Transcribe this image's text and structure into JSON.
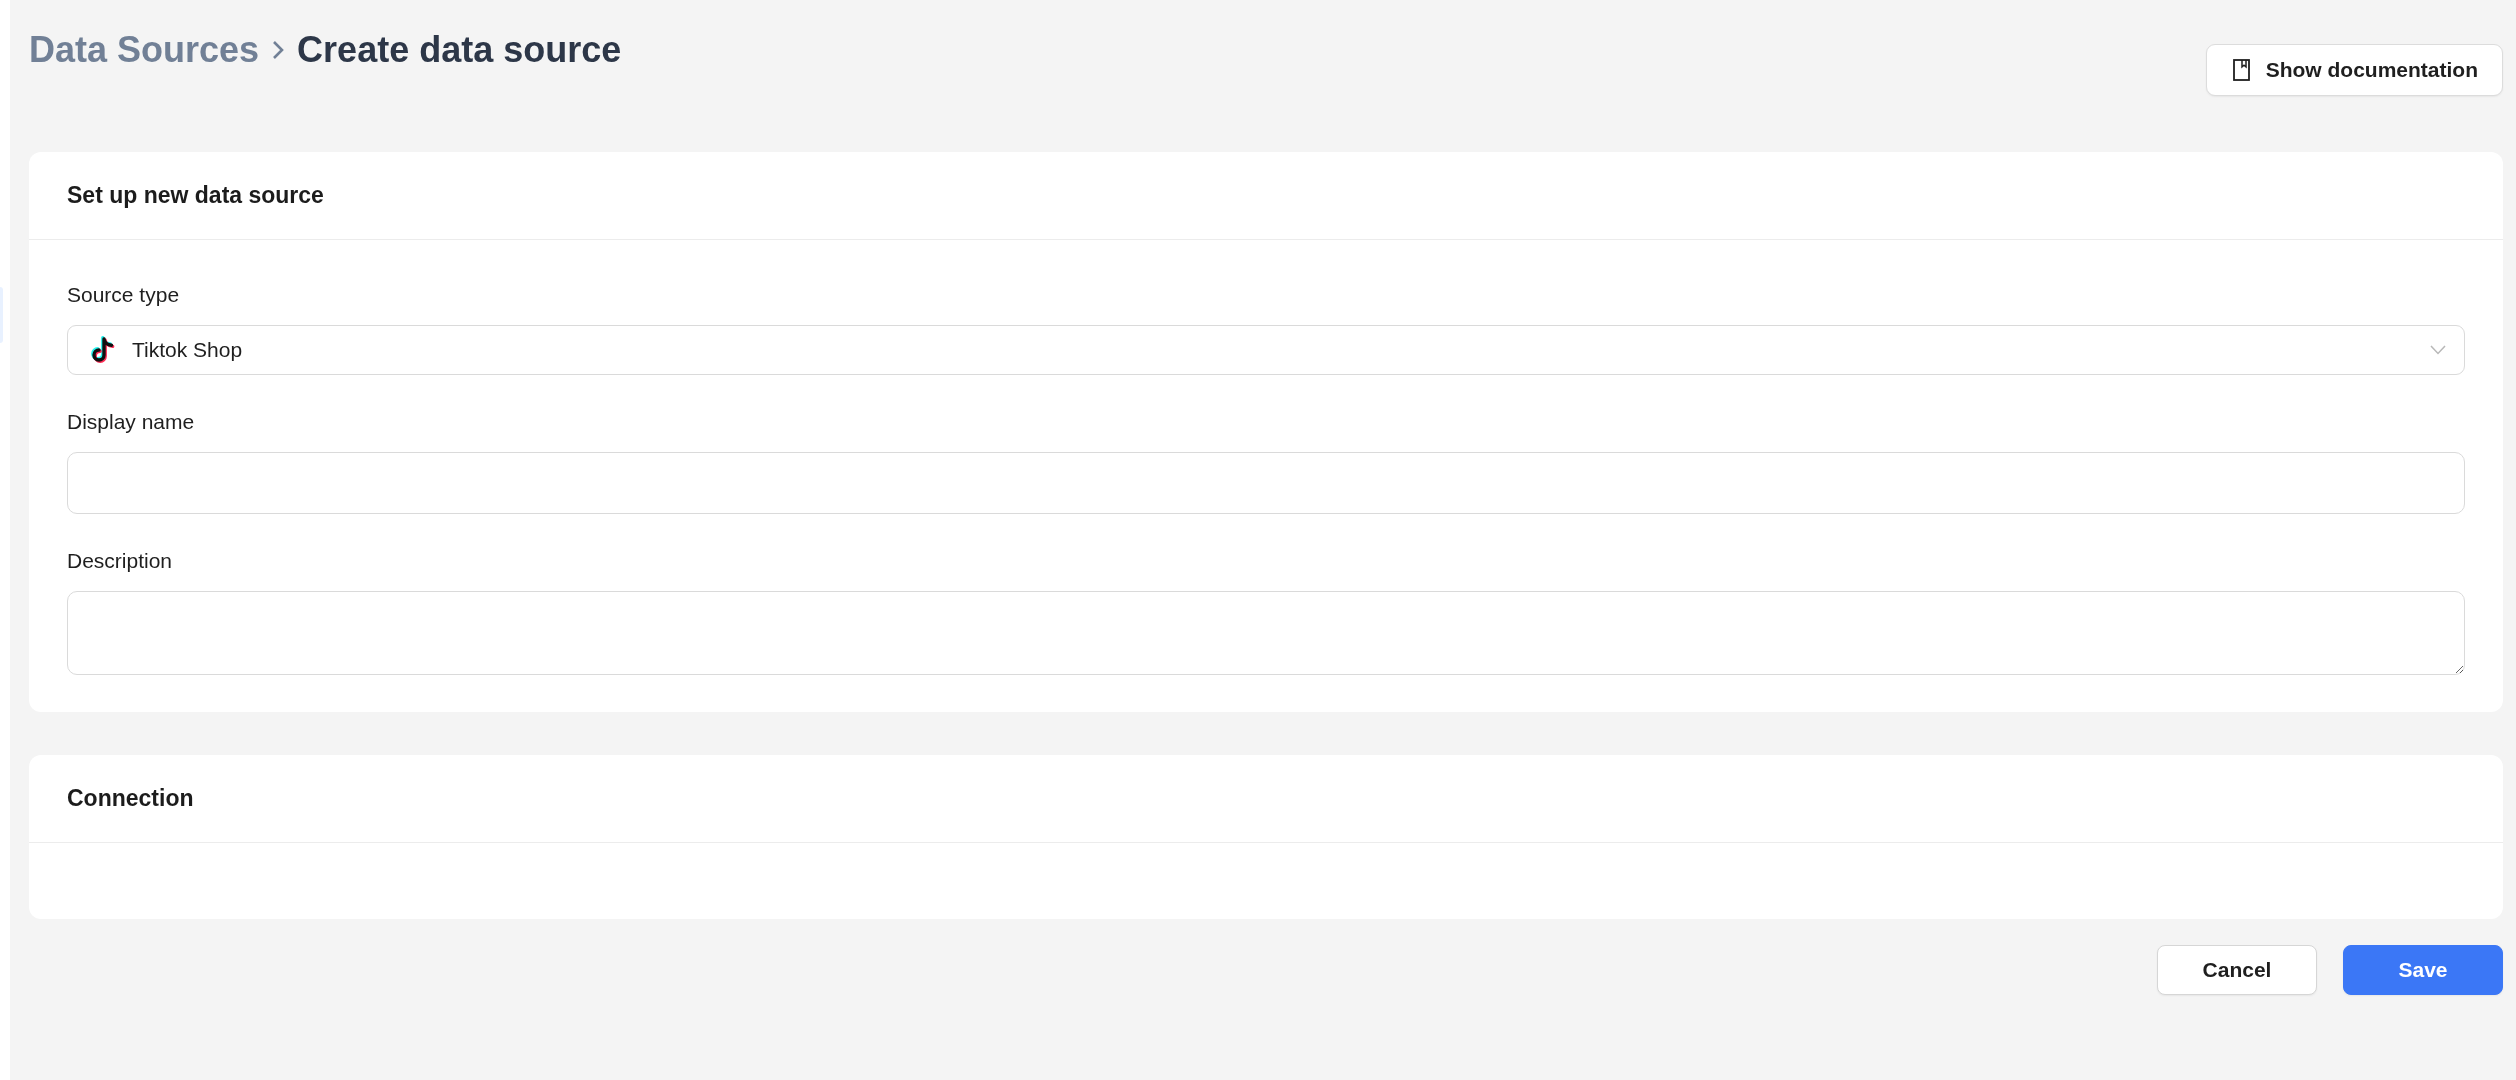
{
  "breadcrumb": [
    {
      "label": "Data Sources",
      "current": false
    },
    {
      "label": "Create data source",
      "current": true
    }
  ],
  "documentation_button": {
    "label": "Show documentation"
  },
  "sections": [
    {
      "title": "Set up new data source",
      "fields": [
        {
          "kind": "select",
          "label": "Source type",
          "value": "Tiktok Shop"
        },
        {
          "kind": "input",
          "label": "Display name"
        },
        {
          "kind": "textarea",
          "label": "Description"
        }
      ]
    },
    {
      "title": "Connection"
    }
  ],
  "actions": [
    {
      "label": "Cancel",
      "kind": "secondary"
    },
    {
      "label": "Save",
      "kind": "primary"
    }
  ]
}
